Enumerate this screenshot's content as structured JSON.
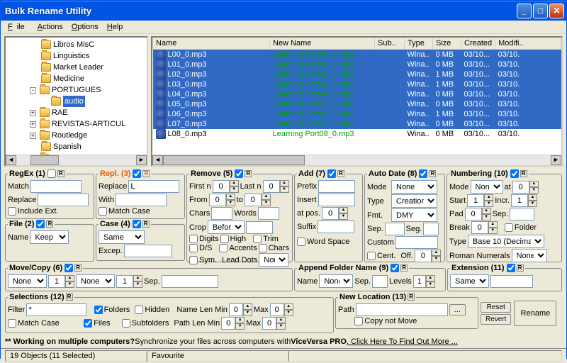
{
  "title": "Bulk Rename Utility",
  "menus": {
    "file": "File",
    "actions": "Actions",
    "options": "Options",
    "help": "Help"
  },
  "tree": {
    "items": [
      {
        "indent": 2,
        "label": "Libros MisC"
      },
      {
        "indent": 2,
        "label": "Linguistics"
      },
      {
        "indent": 2,
        "label": "Market Leader"
      },
      {
        "indent": 2,
        "label": "Medicine"
      },
      {
        "indent": 2,
        "label": "PORTUGUES",
        "exp": "-"
      },
      {
        "indent": 3,
        "label": "audio",
        "sel": true
      },
      {
        "indent": 2,
        "label": "RAE",
        "exp": "+"
      },
      {
        "indent": 2,
        "label": "REVISTAS-ARTICUL",
        "exp": "+"
      },
      {
        "indent": 2,
        "label": "Routledge",
        "exp": "+"
      },
      {
        "indent": 2,
        "label": "Spanish"
      },
      {
        "indent": 2,
        "label": "TRADOS",
        "exp": "+"
      }
    ]
  },
  "columns": {
    "name": "Name",
    "newname": "New Name",
    "sub": "Sub..",
    "type": "Type",
    "size": "Size",
    "created": "Created",
    "modified": "Modifi.."
  },
  "files": [
    {
      "name": "L00_0.mp3",
      "new": "Learning Port00_0.mp3",
      "type": "Wina..",
      "size": "0 MB",
      "created": "03/10...",
      "modified": "03/10."
    },
    {
      "name": "L01_0.mp3",
      "new": "Learning Port01_0.mp3",
      "type": "Wina..",
      "size": "0 MB",
      "created": "03/10...",
      "modified": "03/10."
    },
    {
      "name": "L02_0.mp3",
      "new": "Learning Port02_0.mp3",
      "type": "Wina..",
      "size": "1 MB",
      "created": "03/10...",
      "modified": "03/10."
    },
    {
      "name": "L03_0.mp3",
      "new": "Learning Port03_0.mp3",
      "type": "Wina..",
      "size": "1 MB",
      "created": "03/10...",
      "modified": "03/10."
    },
    {
      "name": "L04_0.mp3",
      "new": "Learning Port04_0.mp3",
      "type": "Wina..",
      "size": "0 MB",
      "created": "03/10...",
      "modified": "03/10."
    },
    {
      "name": "L05_0.mp3",
      "new": "Learning Port05_0.mp3",
      "type": "Wina..",
      "size": "0 MB",
      "created": "03/10...",
      "modified": "03/10."
    },
    {
      "name": "L06_0.mp3",
      "new": "Learning Port06_0.mp3",
      "type": "Wina..",
      "size": "1 MB",
      "created": "03/10...",
      "modified": "03/10."
    },
    {
      "name": "L07_0.mp3",
      "new": "Learning Port07_0.mp3",
      "type": "Wina..",
      "size": "0 MB",
      "created": "03/10...",
      "modified": "03/10."
    },
    {
      "name": "L08_0.mp3",
      "new": "Learning Port08_0.mp3",
      "type": "Wina..",
      "size": "0 MB",
      "created": "03/10...",
      "modified": "03/10.",
      "notsel": true
    }
  ],
  "regex": {
    "title": "RegEx (1)",
    "match_lbl": "Match",
    "match": "",
    "replace_lbl": "Replace",
    "replace": "",
    "inc_ext": "Include Ext."
  },
  "repl": {
    "title": "Repl. (3)",
    "replace_lbl": "Replace",
    "replace": "L",
    "with_lbl": "With",
    "with": "Learning Port",
    "match_case": "Match Case"
  },
  "file": {
    "title": "File (2)",
    "name_lbl": "Name",
    "name_opt": "Keep"
  },
  "case": {
    "title": "Case (4)",
    "opt": "Same",
    "excep_lbl": "Excep."
  },
  "remove": {
    "title": "Remove (5)",
    "firstn": "First n",
    "lastn": "Last n",
    "from": "From",
    "to": "to",
    "chars": "Chars",
    "words": "Words",
    "crop": "Crop",
    "crop_opt": "Before",
    "digits": "Digits",
    "high": "High",
    "trim": "Trim",
    "ds": "D/S",
    "accents": "Accents",
    "chars2": "Chars",
    "sym": "Sym.",
    "lead": "Lead Dots",
    "lead_opt": "Non"
  },
  "add": {
    "title": "Add (7)",
    "prefix": "Prefix",
    "insert": "Insert",
    "atpos": "at pos.",
    "suffix": "Suffix",
    "wordspace": "Word Space"
  },
  "autodate": {
    "title": "Auto Date (8)",
    "mode": "Mode",
    "mode_opt": "None",
    "type": "Type",
    "type_opt": "Creation (Curr",
    "fmt": "Fmt.",
    "fmt_opt": "DMY",
    "sep": "Sep.",
    "seg": "Seg.",
    "custom": "Custom",
    "cent": "Cent.",
    "off": "Off."
  },
  "numbering": {
    "title": "Numbering (10)",
    "mode": "Mode",
    "mode_opt": "None",
    "at": "at",
    "start": "Start",
    "incr": "Incr.",
    "pad": "Pad",
    "sep": "Sep.",
    "break": "Break",
    "folder": "Folder",
    "type": "Type",
    "type_opt": "Base 10 (Decimal)",
    "roman": "Roman Numerals",
    "roman_opt": "None"
  },
  "movecopy": {
    "title": "Move/Copy (6)",
    "none": "None",
    "sep": "Sep."
  },
  "appendfolder": {
    "title": "Append Folder Name (9)",
    "name": "Name",
    "name_opt": "None",
    "sep": "Sep.",
    "levels": "Levels"
  },
  "extension": {
    "title": "Extension (11)",
    "opt": "Same"
  },
  "selections": {
    "title": "Selections (12)",
    "filter": "Filter",
    "filter_val": "*",
    "folders": "Folders",
    "hidden": "Hidden",
    "match_case": "Match Case",
    "files": "Files",
    "subfolders": "Subfolders",
    "namelen": "Name Len Min",
    "pathlen": "Path Len Min",
    "max": "Max"
  },
  "newloc": {
    "title": "New Location (13)",
    "path": "Path",
    "copy": "Copy not Move"
  },
  "buttons": {
    "reset": "Reset",
    "revert": "Revert",
    "rename": "Rename"
  },
  "promo": {
    "prefix": "** Working on multiple computers?",
    "mid": " Synchronize your files across computers with ",
    "brand": "ViceVersa PRO",
    "link": ". Click Here To Find Out More ..."
  },
  "status": {
    "left": "19 Objects (11 Selected)",
    "mid": "Favourite"
  }
}
